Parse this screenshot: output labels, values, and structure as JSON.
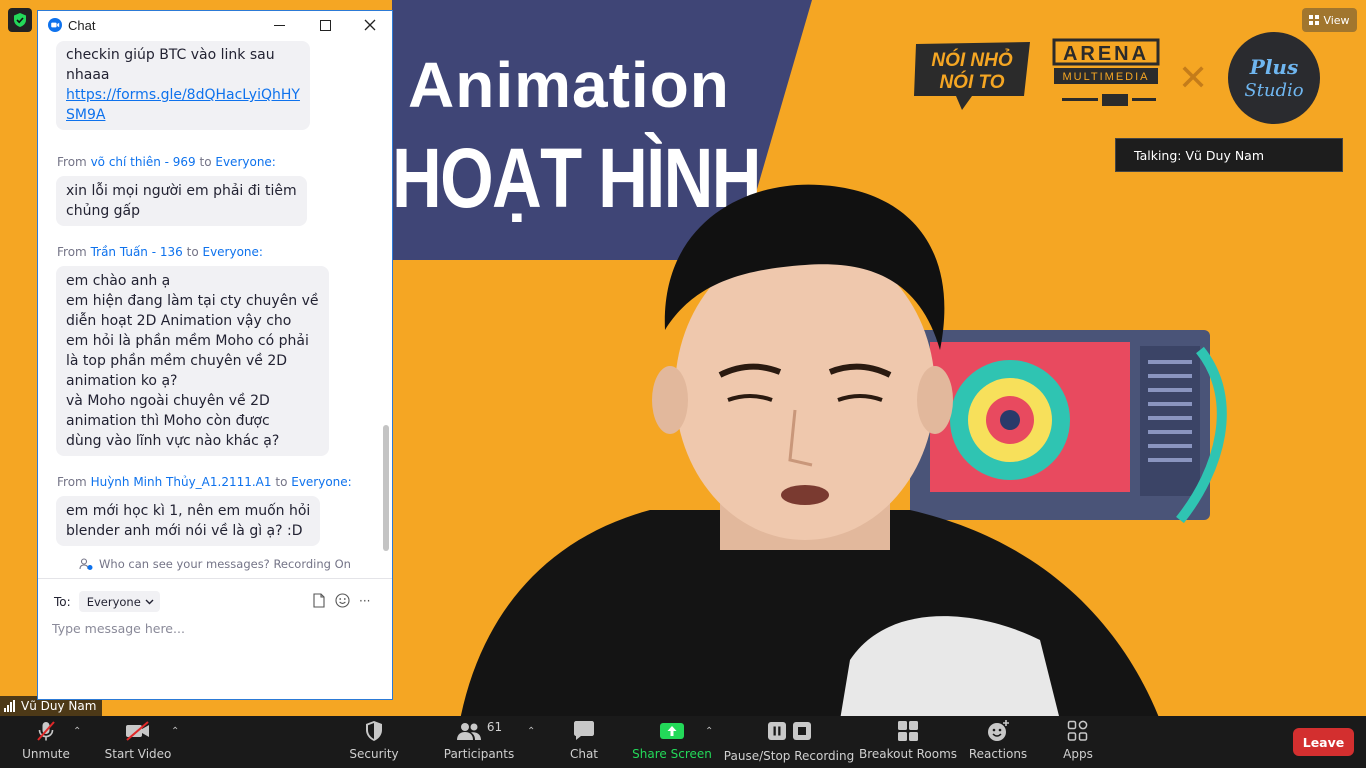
{
  "video": {
    "banner_line1": "Animation",
    "banner_line2": "HOẠT HÌNH",
    "talking": "Talking: Vũ Duy Nam",
    "view_label": "View",
    "speaker_name": "Vũ Duy Nam",
    "logos": {
      "noinho": [
        "NÓI NHỎ",
        "NÓI TO"
      ],
      "arena": [
        "ARENA",
        "MULTIMEDIA"
      ],
      "plus": [
        "Plus",
        "Studio"
      ]
    }
  },
  "chat": {
    "title": "Chat",
    "messages": [
      {
        "lines": [
          "checkin giúp BTC vào link sau",
          "nhaaa"
        ],
        "link_lines": [
          "https://forms.gle/8dQHacLyiQhHY",
          "SM9A"
        ]
      },
      {
        "from_prefix": "From",
        "sender": "võ chí thiên - 969",
        "to_word": "to",
        "recipient": "Everyone:",
        "lines": [
          "xin lỗi mọi người em phải đi tiêm",
          "chủng gấp"
        ]
      },
      {
        "from_prefix": "From",
        "sender": "Trần Tuấn - 136",
        "to_word": "to",
        "recipient": "Everyone:",
        "lines": [
          "em chào anh ạ",
          "em hiện đang làm tại cty chuyên về",
          "diễn hoạt 2D Animation vậy cho",
          "em hỏi là phần mềm Moho có phải",
          "là top phần mềm chuyên về 2D",
          "animation ko ạ?",
          "và Moho ngoài chuyên về 2D",
          "animation thì Moho còn được",
          "dùng vào lĩnh vực nào khác ạ?"
        ]
      },
      {
        "from_prefix": "From",
        "sender": "Huỳnh Minh Thủy_A1.2111.A1",
        "to_word": "to",
        "recipient": "Everyone:",
        "lines": [
          "em mới học kì 1, nên em muốn hỏi",
          "blender anh mới nói về là gì ạ? :D"
        ]
      }
    ],
    "privacy": "Who can see your messages? Recording On",
    "to_label": "To:",
    "to_value": "Everyone",
    "more": "···",
    "placeholder": "Type message here..."
  },
  "toolbar": {
    "unmute": "Unmute",
    "start_video": "Start Video",
    "security": "Security",
    "participants": "Participants",
    "participants_count": "61",
    "chat": "Chat",
    "share_screen": "Share Screen",
    "recording": "Pause/Stop Recording",
    "breakout": "Breakout Rooms",
    "reactions": "Reactions",
    "apps": "Apps",
    "leave": "Leave"
  },
  "colors": {
    "accent": "#0e72ed",
    "share_green": "#23d959",
    "leave_red": "#d32f2f",
    "video_bg": "#f5a623",
    "banner": "#3f4576"
  }
}
